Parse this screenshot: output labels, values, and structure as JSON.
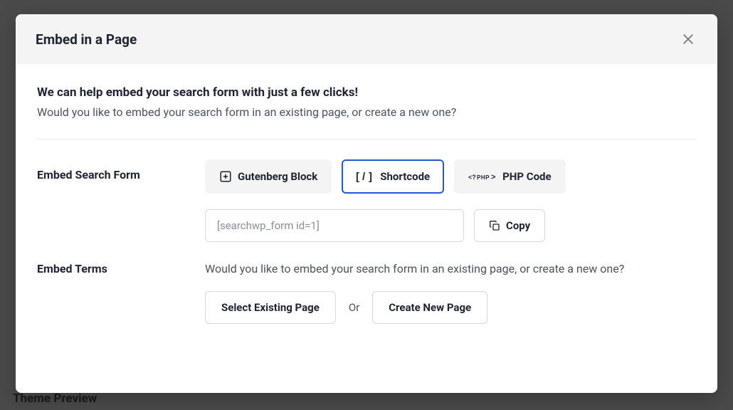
{
  "backdrop": {
    "text": "Theme Preview"
  },
  "modal": {
    "title": "Embed in a Page",
    "intro_heading": "We can help embed your search form with just a few clicks!",
    "intro_sub": "Would you like to embed your search form in an existing page, or create a new one?",
    "embed_form": {
      "label": "Embed Search Form",
      "tabs": {
        "gutenberg": "Gutenberg Block",
        "shortcode": "Shortcode",
        "php": "PHP Code"
      },
      "shortcode_value": "[searchwp_form id=1]",
      "copy_label": "Copy"
    },
    "embed_terms": {
      "label": "Embed Terms",
      "text": "Would you like to embed your search form in an existing page, or create a new one?",
      "select_existing": "Select Existing Page",
      "or": "Or",
      "create_new": "Create New Page"
    }
  }
}
